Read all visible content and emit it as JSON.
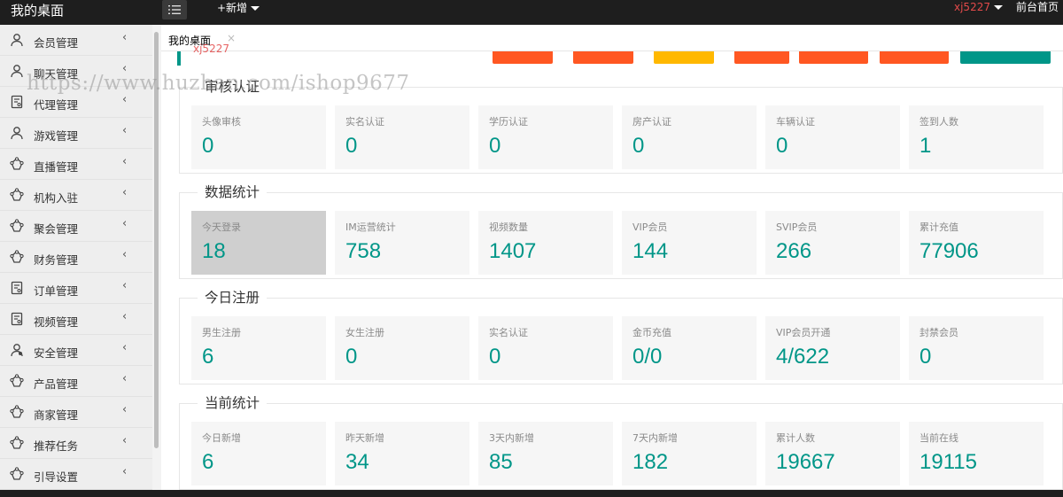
{
  "brand": "我的桌面",
  "topbar": {
    "add_new": "+新增",
    "user": "xj5227",
    "home": "前台首页"
  },
  "sidebar": {
    "items": [
      {
        "label": "会员管理",
        "icon": "user-icon"
      },
      {
        "label": "聊天管理",
        "icon": "user-icon"
      },
      {
        "label": "代理管理",
        "icon": "document-icon"
      },
      {
        "label": "游戏管理",
        "icon": "user-icon"
      },
      {
        "label": "直播管理",
        "icon": "network-icon"
      },
      {
        "label": "机构入驻",
        "icon": "network-icon"
      },
      {
        "label": "聚会管理",
        "icon": "network-icon"
      },
      {
        "label": "财务管理",
        "icon": "network-icon"
      },
      {
        "label": "订单管理",
        "icon": "document-icon"
      },
      {
        "label": "视频管理",
        "icon": "document-icon"
      },
      {
        "label": "安全管理",
        "icon": "user-shield-icon"
      },
      {
        "label": "产品管理",
        "icon": "network-icon"
      },
      {
        "label": "商家管理",
        "icon": "network-icon"
      },
      {
        "label": "推荐任务",
        "icon": "network-icon"
      },
      {
        "label": "引导设置",
        "icon": "network-icon"
      }
    ]
  },
  "tab": {
    "label": "我的桌面",
    "close": "×"
  },
  "partial_header": {
    "red_text": "xj5227",
    "button_colors": [
      "#ff5722",
      "#ff5722",
      "#ffb800",
      "#ff5722",
      "#ff5722",
      "#ff5722",
      "#009688"
    ]
  },
  "watermark": "https://www.huzhan.com/ishop9677",
  "sections": [
    {
      "title": "审核认证",
      "cards": [
        {
          "label": "头像审核",
          "value": "0"
        },
        {
          "label": "实名认证",
          "value": "0"
        },
        {
          "label": "学历认证",
          "value": "0"
        },
        {
          "label": "房产认证",
          "value": "0"
        },
        {
          "label": "车辆认证",
          "value": "0"
        },
        {
          "label": "签到人数",
          "value": "1"
        }
      ]
    },
    {
      "title": "数据统计",
      "cards": [
        {
          "label": "今天登录",
          "value": "18"
        },
        {
          "label": "IM运营统计",
          "value": "758"
        },
        {
          "label": "视频数量",
          "value": "1407"
        },
        {
          "label": "VIP会员",
          "value": "144"
        },
        {
          "label": "SVIP会员",
          "value": "266"
        },
        {
          "label": "累计充值",
          "value": "77906"
        }
      ]
    },
    {
      "title": "今日注册",
      "cards": [
        {
          "label": "男生注册",
          "value": "6"
        },
        {
          "label": "女生注册",
          "value": "0"
        },
        {
          "label": "实名认证",
          "value": "0"
        },
        {
          "label": "金币充值",
          "value": "0/0"
        },
        {
          "label": "VIP会员开通",
          "value": "4/622"
        },
        {
          "label": "封禁会员",
          "value": "0"
        }
      ]
    },
    {
      "title": "当前统计",
      "cards": [
        {
          "label": "今日新增",
          "value": "6"
        },
        {
          "label": "昨天新增",
          "value": "34"
        },
        {
          "label": "3天内新增",
          "value": "85"
        },
        {
          "label": "7天内新增",
          "value": "182"
        },
        {
          "label": "累计人数",
          "value": "19667"
        },
        {
          "label": "当前在线",
          "value": "19115"
        }
      ]
    }
  ],
  "colors": {
    "accent": "#009688",
    "topbar": "#1e1e1e",
    "user": "#e34a4a"
  }
}
